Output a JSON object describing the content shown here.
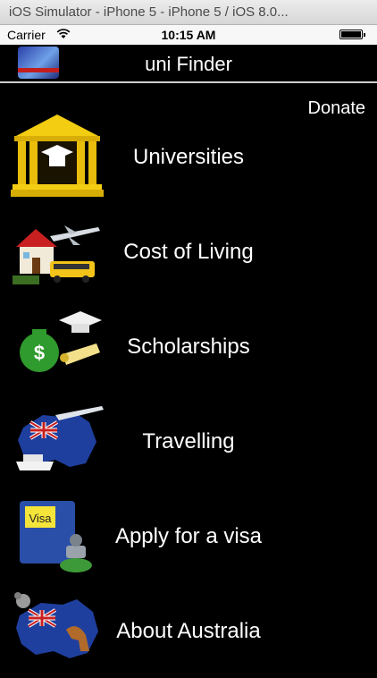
{
  "window": {
    "title": "iOS Simulator - iPhone 5 - iPhone 5 / iOS 8.0..."
  },
  "status_bar": {
    "carrier": "Carrier",
    "time": "10:15 AM"
  },
  "nav": {
    "title": "uni Finder",
    "logo_icon": "uni-finder-logo-icon"
  },
  "donate_label": "Donate",
  "menu": [
    {
      "label": "Universities",
      "icon": "university-building-icon"
    },
    {
      "label": "Cost of Living",
      "icon": "house-plane-bus-icon"
    },
    {
      "label": "Scholarships",
      "icon": "money-bag-graduation-icon"
    },
    {
      "label": "Travelling",
      "icon": "australia-plane-ship-icon"
    },
    {
      "label": "Apply for a visa",
      "icon": "visa-stamp-icon"
    },
    {
      "label": "About Australia",
      "icon": "australia-koala-kangaroo-icon"
    }
  ]
}
